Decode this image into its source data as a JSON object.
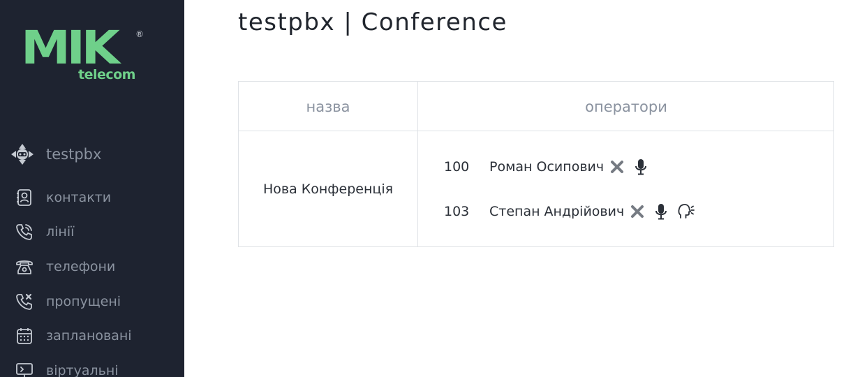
{
  "sidebar": {
    "logo": {
      "brand": "MIK",
      "sub": "telecom",
      "mark": "®"
    },
    "pbx": {
      "label": "testpbx",
      "icon": "pbx-star-icon"
    },
    "items": [
      {
        "label": "контакти",
        "icon": "contacts-icon"
      },
      {
        "label": "лінії",
        "icon": "phone-lines-icon"
      },
      {
        "label": "телефони",
        "icon": "desk-phone-icon"
      },
      {
        "label": "пропущені",
        "icon": "missed-call-icon"
      },
      {
        "label": "заплановані",
        "icon": "calendar-icon"
      },
      {
        "label": "віртуальні",
        "icon": "monitor-icon"
      }
    ]
  },
  "header": {
    "title": "testpbx | Conference"
  },
  "table": {
    "columns": [
      "назва",
      "оператори"
    ],
    "rows": [
      {
        "name": "Нова Конференція",
        "operators": [
          {
            "ext": "100",
            "name": "Роман Осипович",
            "actions": [
              "remove-icon",
              "microphone-icon"
            ]
          },
          {
            "ext": "103",
            "name": "Степан Андрійович",
            "actions": [
              "remove-icon",
              "microphone-icon",
              "speaking-icon"
            ]
          }
        ]
      }
    ]
  },
  "colors": {
    "sidebar_bg": "#1e2330",
    "brand": "#6fd08a",
    "muted_text": "#8b93a0",
    "icon_gray": "#7a7f87"
  }
}
